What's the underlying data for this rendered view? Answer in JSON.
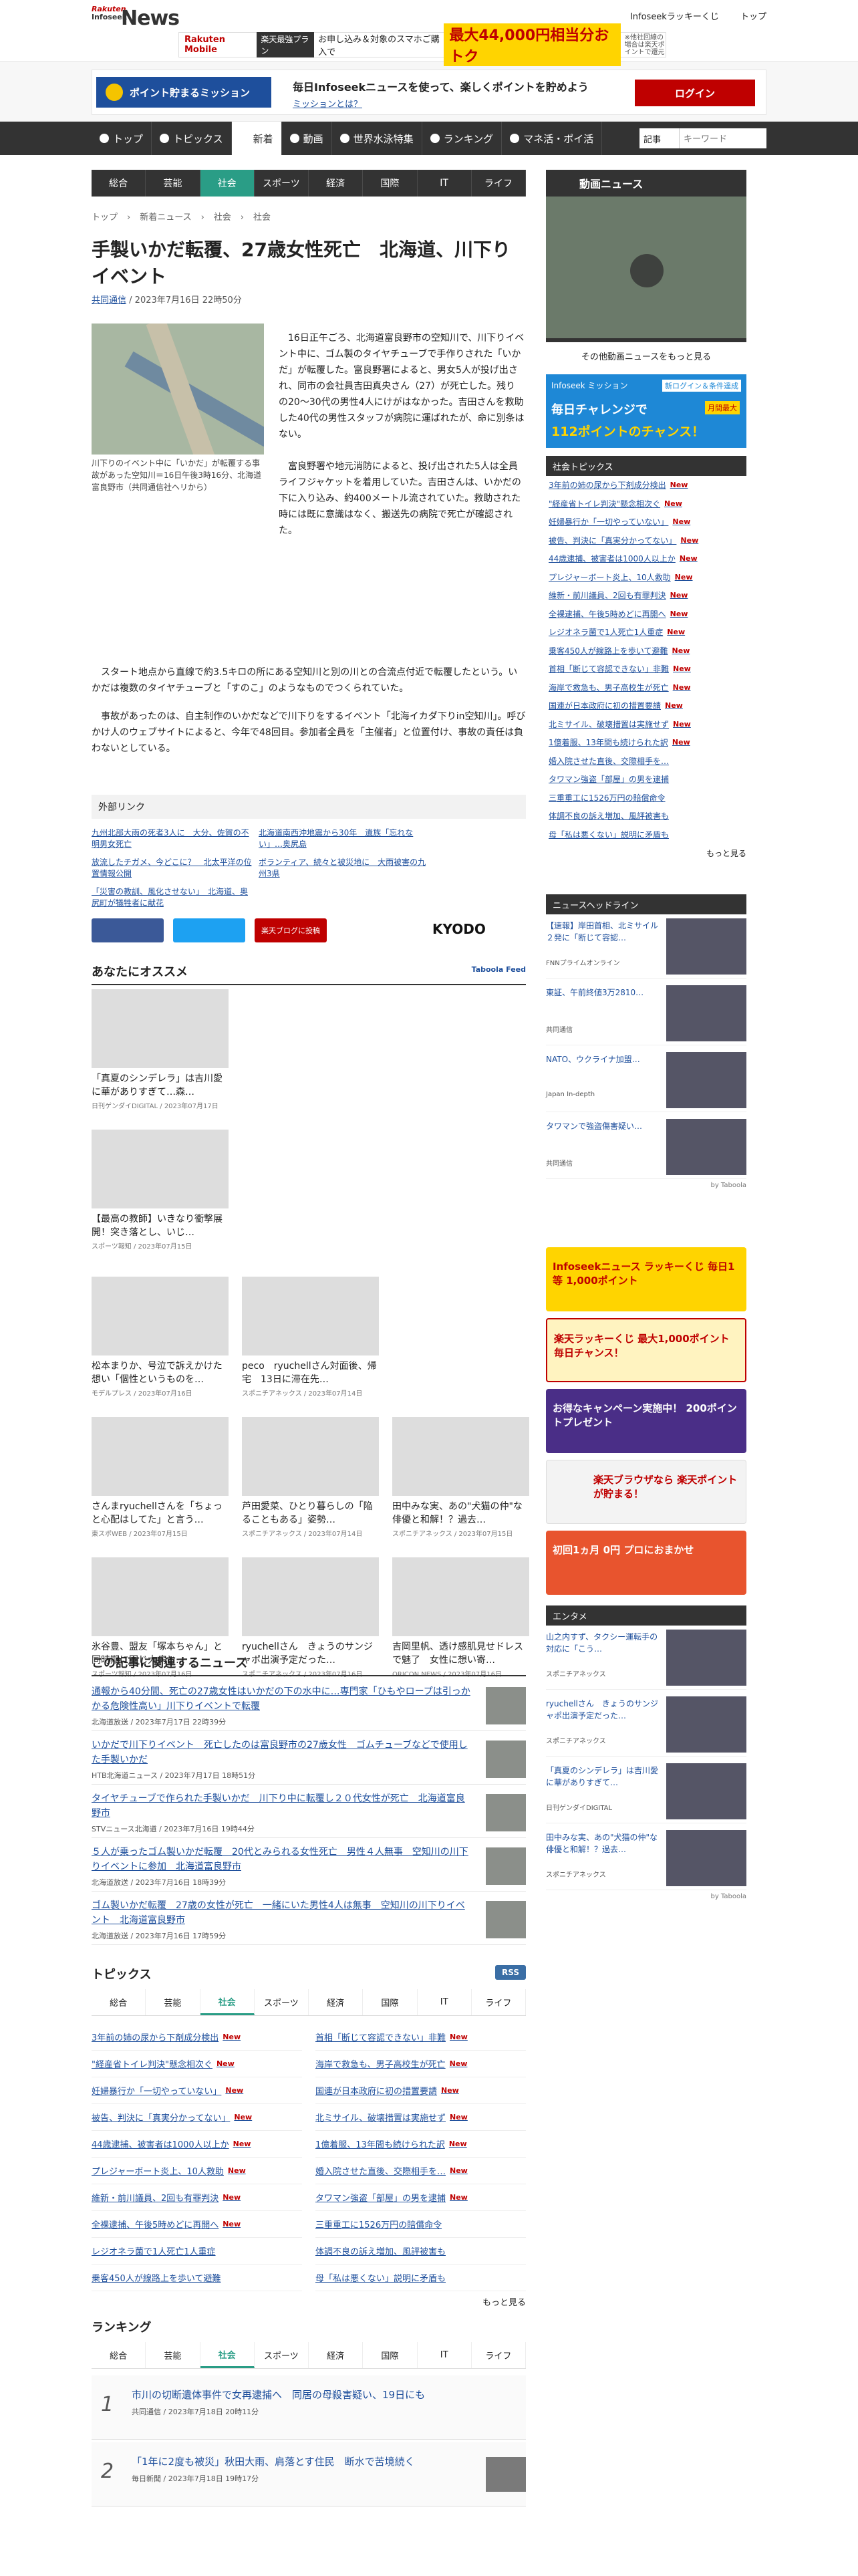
{
  "header": {
    "logo_top": "Rakuten",
    "logo_bottom": "Infoseek",
    "logo_main": "News",
    "lucky": "Infoseekラッキーくじ",
    "top": "トップ",
    "banner": {
      "brand": "Rakuten Mobile",
      "tag": "楽天最強プラン",
      "text": "お申し込み＆対象のスマホご購入で",
      "amount": "最大44,000円相当分おトク",
      "note": "※他社回線の場合は楽天ポイントで還元"
    }
  },
  "mission": {
    "button": "ポイント貯まるミッション",
    "text": "毎日Infoseekニュースを使って、楽しくポイントを貯めよう",
    "link": "ミッションとは？",
    "login": "ログイン"
  },
  "nav": {
    "items": [
      "トップ",
      "トピックス",
      "新着",
      "動画",
      "世界水泳特集",
      "ランキング",
      "マネ活・ポイ活"
    ],
    "active": 2,
    "search_select": "記事",
    "search_placeholder": "キーワード"
  },
  "subnav": {
    "items": [
      "総合",
      "芸能",
      "社会",
      "スポーツ",
      "経済",
      "国際",
      "IT",
      "ライフ"
    ],
    "active": 2
  },
  "breadcrumb": [
    "トップ",
    "新着ニュース",
    "社会",
    "社会"
  ],
  "article": {
    "title": "手製いかだ転覆、27歳女性死亡　北海道、川下りイベント",
    "source": "共同通信",
    "date": "2023年7月16日 22時50分",
    "caption": "川下りのイベント中に「いかだ」が転覆する事故があった空知川＝16日午後3時16分、北海道富良野市（共同通信社ヘリから）",
    "p1": "16日正午ごろ、北海道富良野市の空知川で、川下りイベント中に、ゴム製のタイヤチューブで手作りされた「いかだ」が転覆した。富良野署によると、男女5人が投げ出され、同市の会社員吉田真央さん（27）が死亡した。残り の20～30代の男性4人にけがはなかった。吉田さんを救助した40代の男性スタッフが病院に運ばれたが、命に別条はない。",
    "p2": "富良野署や地元消防によると、投げ出された5人は全員ライフジャケットを着用していた。吉田さんは、いかだの下に入り込み、約400メートル流されていた。救助された時には既に意識はなく、搬送先の病院で死亡が確認された。",
    "p3": "スタート地点から直線で約3.5キロの所にある空知川と別の川との合流点付近で転覆したという。いかだは複数のタイヤチューブと「すのこ」のようなものでつくられていた。",
    "p4": "事故があったのは、自主制作のいかだなどで川下りをするイベント「北海イカダ下りin空知川」。呼びかけ人のウェブサイトによると、今年で48回目。参加者全員を「主催者」と位置付け、事故の責任は負わないとしている。"
  },
  "external": {
    "heading": "外部リンク",
    "links": [
      "九州北部大雨の死者3人に　大分、佐賀の不明男女死亡",
      "北海道南西沖地震から30年　遺族「忘れない」…奥尻島",
      "放流したチガメ、今どこに？　北太平洋の位置情報公開",
      "ボランティア、続々と被災地に　大雨被害の九州3県",
      "「災害の教訓、風化させない」　北海道、奥尻町が犠牲者に献花"
    ]
  },
  "share": {
    "blog": "楽天ブログに投稿",
    "kyodo": "KYODO"
  },
  "recommend": {
    "heading": "あなたにオススメ",
    "powered": "Taboola Feed",
    "cards": [
      {
        "title": "「真夏のシンデレラ」は吉川愛に華がありすぎて…森…",
        "src": "日刊ゲンダイDIGITAL / 2023年07月17日"
      },
      {
        "title": "【最高の教師】いきなり衝撃展開！突き落とし、いじ…",
        "src": "スポーツ報知 / 2023年07月15日"
      },
      {
        "title": "松本まりか、号泣で訴えかけた想い「個性というものを…",
        "src": "モデルプレス / 2023年07月16日"
      },
      {
        "title": "peco　ryuchellさん対面後、帰宅　13日に滞在先…",
        "src": "スポニチアネックス / 2023年07月14日"
      },
      {
        "title": "さんまryuchellさんを「ちょっと心配はしてた」と言う…",
        "src": "東スポWEB / 2023年07月15日"
      },
      {
        "title": "芦田愛菜、ひとり暮らしの「陥ることもある」姿勢…",
        "src": "スポニチアネックス / 2023年07月14日"
      },
      {
        "title": "田中みな実、あの\"犬猫の仲\"な俳優と和解！？過去…",
        "src": "スポニチアネックス / 2023年07月15日"
      },
      {
        "title": "氷谷豊、盟友「塚本ちゃん」と同時期に同じ大病と…",
        "src": "スポーツ報知 / 2023年07月16日"
      },
      {
        "title": "ryuchellさん　きょうのサンジャポ出演予定だった…",
        "src": "スポニチアネックス / 2023年07月16日"
      },
      {
        "title": "吉岡里帆、透け感肌見せドレスで魅了　女性に想い寄…",
        "src": "ORICON NEWS / 2023年07月16日"
      }
    ]
  },
  "related": {
    "heading": "この記事に関連するニュース",
    "items": [
      {
        "title": "通報から40分間、死亡の27歳女性はいかだの下の水中に…専門家「ひもやロープは引っかかる危険性高い」川下りイベントで転覆",
        "src": "北海道放送 / 2023年7月17日 22時39分"
      },
      {
        "title": "いかだで川下りイベント　死亡したのは富良野市の27歳女性　ゴムチューブなどで使用した手製いかだ",
        "src": "HTB北海道ニュース / 2023年7月17日 18時51分"
      },
      {
        "title": "タイヤチューブで作られた手製いかだ　川下り中に転覆し２０代女性が死亡　北海道富良野市",
        "src": "STVニュース北海道 / 2023年7月16日 19時44分"
      },
      {
        "title": "５人が乗ったゴム製いかだ転覆　20代とみられる女性死亡　男性４人無事　空知川の川下りイベントに参加　北海道富良野市",
        "src": "北海道放送 / 2023年7月16日 18時39分"
      },
      {
        "title": "ゴム製いかだ転覆　27歳の女性が死亡　一緒にいた男性4人は無事　空知川の川下りイベント　北海道富良野市",
        "src": "北海道放送 / 2023年7月16日 17時59分"
      }
    ]
  },
  "topics": {
    "heading": "トピックス",
    "rss": "RSS",
    "tabs": [
      "総合",
      "芸能",
      "社会",
      "スポーツ",
      "経済",
      "国際",
      "IT",
      "ライフ"
    ],
    "active": 2,
    "new": "New",
    "more": "もっと見る",
    "items": [
      "3年前の姉の尿から下剤成分検出",
      "首相「断じて容認できない」非難",
      "\"経産省トイレ判決\"懸念相次ぐ",
      "海岸で救急も、男子高校生が死亡",
      "妊婦暴行か「一切やっていない」",
      "国連が日本政府に初の措置要請",
      "被告、判決に「真実分かってない」",
      "北ミサイル、破壊措置は実施せず",
      "44歳逮捕、被害者は1000人以上か",
      "1億着服、13年間も続けられた訳",
      "プレジャーボート炎上、10人救助",
      "婚入院させた直後、交際相手を…",
      "維新・前川議員、2回も有罪判決",
      "タワマン強盗「部屋」の男を逮捕",
      "全裸逮捕、午後5時めどに再開へ",
      "三重重工に1526万円の賠償命令",
      "レジオネラ菌で1人死亡1人重症",
      "体調不良の訴え増加、風評被害も",
      "乗客450人が線路上を歩いて避難",
      "母「私は悪くない」説明に矛盾も"
    ]
  },
  "ranking": {
    "heading": "ランキング",
    "tabs": [
      "総合",
      "芸能",
      "社会",
      "スポーツ",
      "経済",
      "国際",
      "IT",
      "ライフ"
    ],
    "active": 2,
    "items": [
      {
        "title": "市川の切断遺体事件で女再逮捕へ　同居の母殺害疑い、19日にも",
        "src": "共同通信 / 2023年7月18日 20時11分"
      },
      {
        "title": "「1年に2度も被災」秋田大雨、肩落とす住民　断水で苦境続く",
        "src": "毎日新聞 / 2023年7月18日 19時17分"
      }
    ]
  },
  "sidebar": {
    "video": {
      "heading": "動画ニュース",
      "more": "その他動画ニュースをもっと見る"
    },
    "ad1": {
      "l1": "Infoseek ミッション",
      "l2": "新ログイン＆条件達成",
      "l3": "毎日チャレンジで",
      "l4": "月間最大",
      "l5": "112ポイントのチャンス！"
    },
    "social": {
      "heading": "社会トピックス",
      "new": "New",
      "more": "もっと見る",
      "items": [
        "3年前の姉の尿から下剤成分検出",
        "\"経産省トイレ判決\"懸念相次ぐ",
        "妊婦暴行か「一切やっていない」",
        "被告、判決に「真実分かってない」",
        "44歳逮捕、被害者は1000人以上か",
        "プレジャーボート炎上、10人救助",
        "維新・前川議員、2回も有罪判決",
        "全裸逮捕、午後5時めどに再開へ",
        "レジオネラ菌で1人死亡1人重症",
        "乗客450人が線路上を歩いて避難",
        "首相「断じて容認できない」非難",
        "海岸で救急も、男子高校生が死亡",
        "国連が日本政府に初の措置要請",
        "北ミサイル、破壊措置は実施せず",
        "1億着服、13年間も続けられた訳",
        "婚入院させた直後、交際相手を…",
        "タワマン強盗「部屋」の男を逮捕",
        "三重重工に1526万円の賠償命令",
        "体調不良の訴え増加、風評被害も",
        "母「私は悪くない」説明に矛盾も"
      ]
    },
    "headlines": {
      "heading": "ニュースヘッドライン",
      "items": [
        {
          "title": "【速報】岸田首相、北ミサイル２発に「断じて容認…",
          "src": "FNNプライムオンライン"
        },
        {
          "title": "東証、午前終値3万2810…",
          "src": "共同通信"
        },
        {
          "title": "NATO、ウクライナ加盟…",
          "src": "Japan In-depth"
        },
        {
          "title": "タワマンで強盗傷害疑い…",
          "src": "共同通信"
        }
      ],
      "by": "by Taboola"
    },
    "ads": {
      "a1": "Infoseekニュース ラッキーくじ 毎日1等 1,000ポイント",
      "a2": "楽天ラッキーくじ 最大1,000ポイント 毎日チャンス！",
      "a3": "お得なキャンペーン実施中！ 200ポイントプレゼント",
      "a4": "楽天ブラウザなら 楽天ポイントが貯まる！",
      "a5": "初回1ヵ月 0円 プロにおまかせ"
    },
    "ent": {
      "heading": "エンタメ",
      "items": [
        {
          "title": "山之内すず、タクシー運転手の対応に「こう…",
          "src": "スポニチアネックス"
        },
        {
          "title": "ryuchellさん　きょうのサンジャポ出演予定だった…",
          "src": "スポニチアネックス"
        },
        {
          "title": "「真夏のシンデレラ」は吉川愛に華がありすぎて…",
          "src": "日刊ゲンダイDIGITAL"
        },
        {
          "title": "田中みな実、あの\"犬猫の仲\"な俳優と和解！？過去…",
          "src": "スポニチアネックス"
        }
      ],
      "by": "by Taboola"
    }
  }
}
